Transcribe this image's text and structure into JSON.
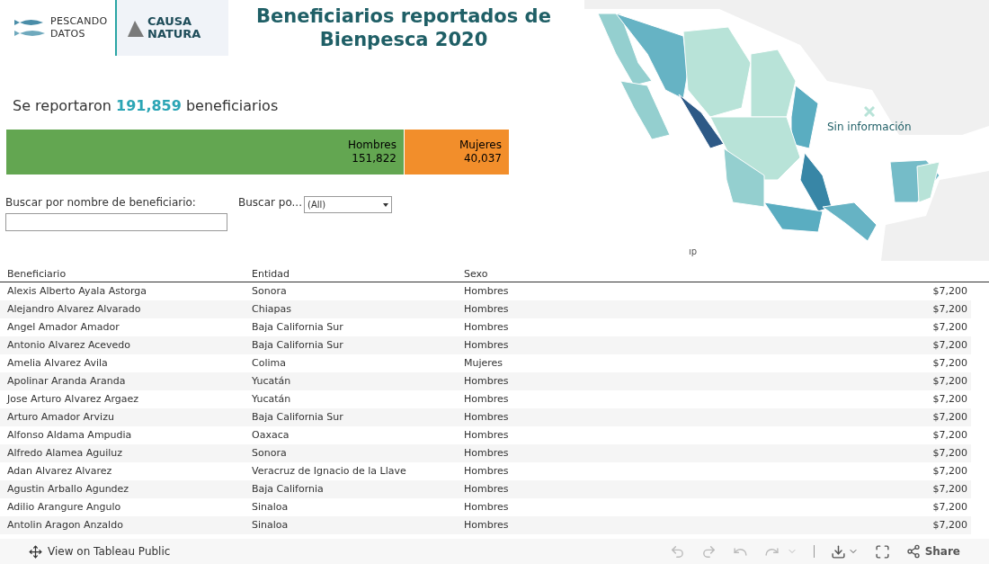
{
  "header": {
    "logo_left": [
      "PESCANDO",
      "DATOS"
    ],
    "logo_right": [
      "CAUSA",
      "NATURA"
    ],
    "title": "Beneficiarios reportados de Bienpesca 2020"
  },
  "summary": {
    "text": "Se reportaron ",
    "count": "191,859",
    "suffix": " beneficiarios"
  },
  "bar": [
    {
      "label": "Hombres",
      "value": "151,822",
      "level": 0.791,
      "color": "#63a651"
    },
    {
      "label": "Mujeres",
      "value": "40,037",
      "level": 0.209,
      "color": "#f28e2b"
    }
  ],
  "filters": {
    "name_label": "Buscar por nombre de beneficiario:",
    "sex_label": "Buscar po...",
    "sex_value": "(All)"
  },
  "map": {
    "legend": "Sin información",
    "attribution": "ıp"
  },
  "table": {
    "columns": [
      "Beneficiario",
      "Entidad",
      "Sexo"
    ],
    "rows": [
      [
        "Alexis Alberto Ayala Astorga",
        "Sonora",
        "Hombres",
        "$7,200"
      ],
      [
        "Alejandro Alvarez Alvarado",
        "Chiapas",
        "Hombres",
        "$7,200"
      ],
      [
        "Angel Amador Amador",
        "Baja California Sur",
        "Hombres",
        "$7,200"
      ],
      [
        "Antonio Alvarez Acevedo",
        "Baja California Sur",
        "Hombres",
        "$7,200"
      ],
      [
        "Amelia Alvarez Avila",
        "Colima",
        "Mujeres",
        "$7,200"
      ],
      [
        "Apolinar Aranda Aranda",
        "Yucatán",
        "Hombres",
        "$7,200"
      ],
      [
        "Jose Arturo Alvarez Argaez",
        "Yucatán",
        "Hombres",
        "$7,200"
      ],
      [
        "Arturo Amador Arvizu",
        "Baja California Sur",
        "Hombres",
        "$7,200"
      ],
      [
        "Alfonso Aldama Ampudia",
        "Oaxaca",
        "Hombres",
        "$7,200"
      ],
      [
        "Alfredo Alamea Aguiluz",
        "Sonora",
        "Hombres",
        "$7,200"
      ],
      [
        "Adan Alvarez Alvarez",
        "Veracruz de Ignacio de la Llave",
        "Hombres",
        "$7,200"
      ],
      [
        "Agustin Arballo Agundez",
        "Baja California",
        "Hombres",
        "$7,200"
      ],
      [
        "Adilio Arangure Angulo",
        "Sinaloa",
        "Hombres",
        "$7,200"
      ],
      [
        "Antolin Aragon Anzaldo",
        "Sinaloa",
        "Hombres",
        "$7,200"
      ]
    ]
  },
  "toolbar": {
    "view_link": "View on Tableau Public",
    "share": "Share",
    "history": [
      {
        "kind": "undo",
        "disabled": true
      },
      {
        "kind": "redo",
        "disabled": true
      },
      {
        "kind": "revert",
        "disabled": true
      },
      {
        "kind": "refresh",
        "disabled": true
      }
    ]
  }
}
